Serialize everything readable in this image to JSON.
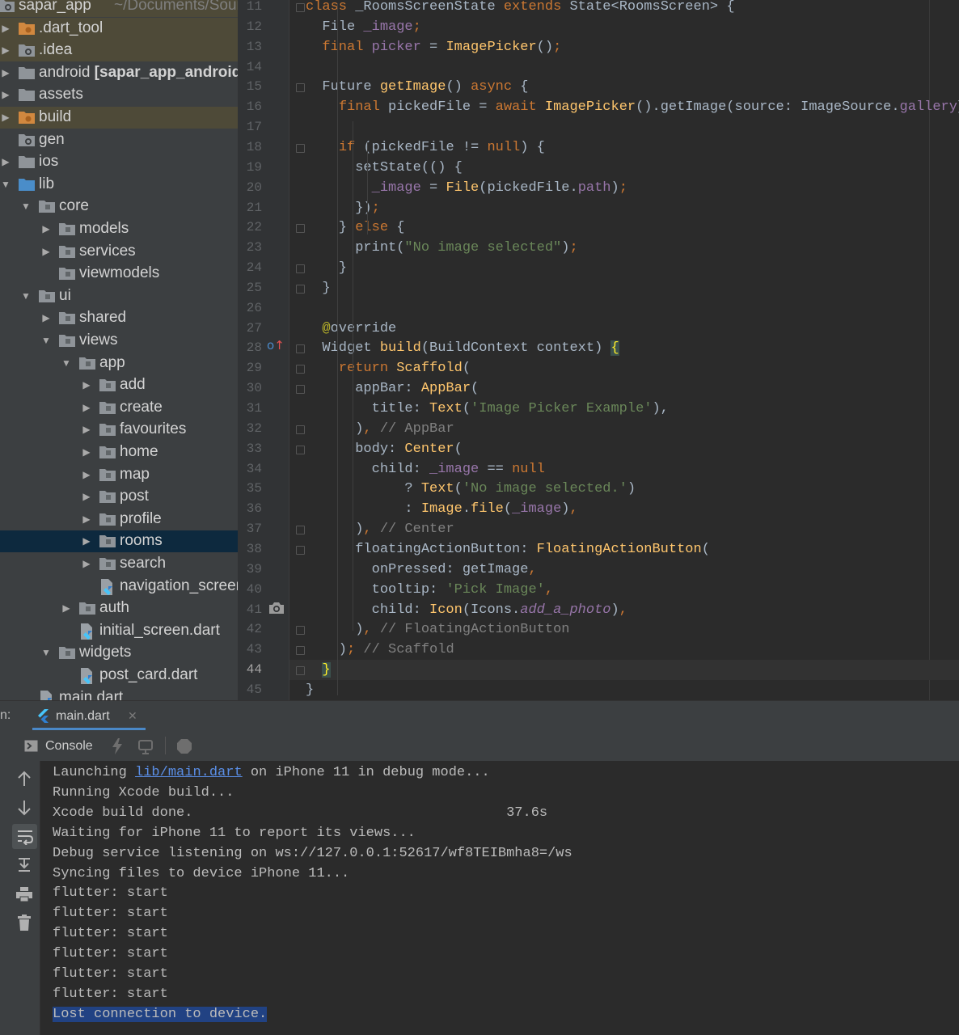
{
  "project_tree": {
    "items": [
      {
        "depth": 0,
        "type": "folder",
        "arrow": "right",
        "label": "sapar_app",
        "extra": "~/Documents/Sources",
        "color": "module",
        "highlight": "tan"
      },
      {
        "depth": 1,
        "type": "folder",
        "arrow": "right",
        "label": ".dart_tool",
        "color": "orange",
        "highlight": "tan"
      },
      {
        "depth": 1,
        "type": "folder",
        "arrow": "right",
        "label": ".idea",
        "color": "gray-gear",
        "highlight": "tan"
      },
      {
        "depth": 1,
        "type": "folder",
        "arrow": "right",
        "label": "android",
        "label_bold": "[sapar_app_android]",
        "color": "gray"
      },
      {
        "depth": 1,
        "type": "folder",
        "arrow": "right",
        "label": "assets",
        "color": "gray"
      },
      {
        "depth": 1,
        "type": "folder",
        "arrow": "right",
        "label": "build",
        "color": "orange",
        "highlight": "tan"
      },
      {
        "depth": 1,
        "type": "folder",
        "arrow": "none",
        "label": "gen",
        "color": "gray-gear"
      },
      {
        "depth": 1,
        "type": "folder",
        "arrow": "right",
        "label": "ios",
        "color": "gray"
      },
      {
        "depth": 1,
        "type": "folder",
        "arrow": "down",
        "label": "lib",
        "color": "blue"
      },
      {
        "depth": 2,
        "type": "folder",
        "arrow": "down",
        "label": "core",
        "color": "gray-dot"
      },
      {
        "depth": 3,
        "type": "folder",
        "arrow": "right",
        "label": "models",
        "color": "gray-dot"
      },
      {
        "depth": 3,
        "type": "folder",
        "arrow": "right",
        "label": "services",
        "color": "gray-dot"
      },
      {
        "depth": 3,
        "type": "folder",
        "arrow": "none",
        "label": "viewmodels",
        "color": "gray-dot"
      },
      {
        "depth": 2,
        "type": "folder",
        "arrow": "down",
        "label": "ui",
        "color": "gray-dot"
      },
      {
        "depth": 3,
        "type": "folder",
        "arrow": "right",
        "label": "shared",
        "color": "gray-dot"
      },
      {
        "depth": 3,
        "type": "folder",
        "arrow": "down",
        "label": "views",
        "color": "gray-dot"
      },
      {
        "depth": 4,
        "type": "folder",
        "arrow": "down",
        "label": "app",
        "color": "gray-dot"
      },
      {
        "depth": 5,
        "type": "folder",
        "arrow": "right",
        "label": "add",
        "color": "gray-dot"
      },
      {
        "depth": 5,
        "type": "folder",
        "arrow": "right",
        "label": "create",
        "color": "gray-dot"
      },
      {
        "depth": 5,
        "type": "folder",
        "arrow": "right",
        "label": "favourites",
        "color": "gray-dot"
      },
      {
        "depth": 5,
        "type": "folder",
        "arrow": "right",
        "label": "home",
        "color": "gray-dot"
      },
      {
        "depth": 5,
        "type": "folder",
        "arrow": "right",
        "label": "map",
        "color": "gray-dot"
      },
      {
        "depth": 5,
        "type": "folder",
        "arrow": "right",
        "label": "post",
        "color": "gray-dot"
      },
      {
        "depth": 5,
        "type": "folder",
        "arrow": "right",
        "label": "profile",
        "color": "gray-dot"
      },
      {
        "depth": 5,
        "type": "folder",
        "arrow": "right",
        "label": "rooms",
        "color": "gray-dot",
        "selected": true
      },
      {
        "depth": 5,
        "type": "folder",
        "arrow": "right",
        "label": "search",
        "color": "gray-dot"
      },
      {
        "depth": 5,
        "type": "file",
        "arrow": "none",
        "label": "navigation_screen.dart"
      },
      {
        "depth": 4,
        "type": "folder",
        "arrow": "right",
        "label": "auth",
        "color": "gray-dot"
      },
      {
        "depth": 4,
        "type": "file",
        "arrow": "none",
        "label": "initial_screen.dart"
      },
      {
        "depth": 3,
        "type": "folder",
        "arrow": "down",
        "label": "widgets",
        "color": "gray-dot"
      },
      {
        "depth": 4,
        "type": "file",
        "arrow": "none",
        "label": "post_card.dart"
      },
      {
        "depth": 2,
        "type": "file",
        "arrow": "none",
        "label": "main.dart"
      }
    ]
  },
  "editor": {
    "current_line": 44,
    "lines": [
      {
        "n": 11,
        "t": [
          [
            "kw",
            "class "
          ],
          [
            "",
            "_RoomsScreenState "
          ],
          [
            "kw",
            "extends "
          ],
          [
            "",
            "State<RoomsScreen> {"
          ]
        ]
      },
      {
        "n": 12,
        "t": [
          [
            "",
            "  File "
          ],
          [
            "fld",
            "_image"
          ],
          [
            "kw",
            ";"
          ]
        ]
      },
      {
        "n": 13,
        "t": [
          [
            "",
            "  "
          ],
          [
            "kw",
            "final "
          ],
          [
            "fld",
            "picker "
          ],
          [
            "",
            "= "
          ],
          [
            "ty",
            "ImagePicker"
          ],
          [
            "",
            "()"
          ],
          [
            "kw",
            ";"
          ]
        ]
      },
      {
        "n": 14,
        "t": []
      },
      {
        "n": 15,
        "t": [
          [
            "",
            "  Future "
          ],
          [
            "ty",
            "getImage"
          ],
          [
            "",
            "() "
          ],
          [
            "kw",
            "async "
          ],
          [
            "",
            "{"
          ]
        ]
      },
      {
        "n": 16,
        "t": [
          [
            "",
            "    "
          ],
          [
            "kw",
            "final "
          ],
          [
            "",
            "pickedFile = "
          ],
          [
            "kw",
            "await "
          ],
          [
            "ty",
            "ImagePicker"
          ],
          [
            "",
            "().getImage(source: ImageSource."
          ],
          [
            "fld",
            "gallery"
          ],
          [
            "",
            "}"
          ],
          [
            "kw",
            ";"
          ]
        ]
      },
      {
        "n": 17,
        "t": []
      },
      {
        "n": 18,
        "t": [
          [
            "",
            "    "
          ],
          [
            "kw",
            "if "
          ],
          [
            "",
            "(pickedFile != "
          ],
          [
            "kw",
            "null"
          ],
          [
            "",
            ") {"
          ]
        ]
      },
      {
        "n": 19,
        "t": [
          [
            "",
            "      setState(() {"
          ]
        ]
      },
      {
        "n": 20,
        "t": [
          [
            "",
            "        "
          ],
          [
            "fld",
            "_image "
          ],
          [
            "",
            "= "
          ],
          [
            "ty",
            "File"
          ],
          [
            "",
            "(pickedFile."
          ],
          [
            "fld",
            "path"
          ],
          [
            "",
            ")"
          ],
          [
            "kw",
            ";"
          ]
        ]
      },
      {
        "n": 21,
        "t": [
          [
            "",
            "      })"
          ],
          [
            "kw",
            ";"
          ]
        ]
      },
      {
        "n": 22,
        "t": [
          [
            "",
            "    } "
          ],
          [
            "kw",
            "else "
          ],
          [
            "",
            "{"
          ]
        ]
      },
      {
        "n": 23,
        "t": [
          [
            "",
            "      print("
          ],
          [
            "str",
            "\"No image selected\""
          ],
          [
            "",
            ")"
          ],
          [
            "kw",
            ";"
          ]
        ]
      },
      {
        "n": 24,
        "t": [
          [
            "",
            "    }"
          ]
        ]
      },
      {
        "n": 25,
        "t": [
          [
            "",
            "  }"
          ]
        ]
      },
      {
        "n": 26,
        "t": []
      },
      {
        "n": 27,
        "t": [
          [
            "",
            "  "
          ],
          [
            "ann",
            "@"
          ],
          [
            "",
            "override"
          ]
        ]
      },
      {
        "n": 28,
        "t": [
          [
            "",
            "  Widget "
          ],
          [
            "ty",
            "build"
          ],
          [
            "",
            "(BuildContext context) "
          ],
          [
            "brk",
            "{"
          ]
        ]
      },
      {
        "n": 29,
        "t": [
          [
            "",
            "    "
          ],
          [
            "kw",
            "return "
          ],
          [
            "ty",
            "Scaffold"
          ],
          [
            "",
            "("
          ]
        ]
      },
      {
        "n": 30,
        "t": [
          [
            "",
            "      appBar: "
          ],
          [
            "ty",
            "AppBar"
          ],
          [
            "",
            "("
          ]
        ]
      },
      {
        "n": 31,
        "t": [
          [
            "",
            "        title: "
          ],
          [
            "ty",
            "Text"
          ],
          [
            "",
            "("
          ],
          [
            "str",
            "'Image Picker Example'"
          ],
          [
            "",
            "),"
          ]
        ]
      },
      {
        "n": 32,
        "t": [
          [
            "",
            "      )"
          ],
          [
            "kw",
            ", "
          ],
          [
            "cm",
            "// AppBar"
          ]
        ]
      },
      {
        "n": 33,
        "t": [
          [
            "",
            "      body: "
          ],
          [
            "ty",
            "Center"
          ],
          [
            "",
            "("
          ]
        ]
      },
      {
        "n": 34,
        "t": [
          [
            "",
            "        child: "
          ],
          [
            "fld",
            "_image "
          ],
          [
            "",
            "== "
          ],
          [
            "kw",
            "null"
          ]
        ]
      },
      {
        "n": 35,
        "t": [
          [
            "",
            "            ? "
          ],
          [
            "ty",
            "Text"
          ],
          [
            "",
            "("
          ],
          [
            "str",
            "'No image selected.'"
          ],
          [
            "",
            ")"
          ]
        ]
      },
      {
        "n": 36,
        "t": [
          [
            "",
            "            : "
          ],
          [
            "ty",
            "Image"
          ],
          [
            "",
            "."
          ],
          [
            "ty",
            "file"
          ],
          [
            "",
            "("
          ],
          [
            "fld",
            "_image"
          ],
          [
            "",
            ")"
          ],
          [
            "kw",
            ","
          ]
        ]
      },
      {
        "n": 37,
        "t": [
          [
            "",
            "      )"
          ],
          [
            "kw",
            ", "
          ],
          [
            "cm",
            "// Center"
          ]
        ]
      },
      {
        "n": 38,
        "t": [
          [
            "",
            "      floatingActionButton: "
          ],
          [
            "ty",
            "FloatingActionButton"
          ],
          [
            "",
            "("
          ]
        ]
      },
      {
        "n": 39,
        "t": [
          [
            "",
            "        onPressed: getImage"
          ],
          [
            "kw",
            ","
          ]
        ]
      },
      {
        "n": 40,
        "t": [
          [
            "",
            "        tooltip: "
          ],
          [
            "str",
            "'Pick Image'"
          ],
          [
            "kw",
            ","
          ]
        ]
      },
      {
        "n": 41,
        "t": [
          [
            "",
            "        child: "
          ],
          [
            "ty",
            "Icon"
          ],
          [
            "",
            "(Icons."
          ],
          [
            "it",
            "add_a_photo"
          ],
          [
            "",
            ")"
          ],
          [
            "kw",
            ","
          ]
        ]
      },
      {
        "n": 42,
        "t": [
          [
            "",
            "      )"
          ],
          [
            "kw",
            ", "
          ],
          [
            "cm",
            "// FloatingActionButton"
          ]
        ]
      },
      {
        "n": 43,
        "t": [
          [
            "",
            "    )"
          ],
          [
            "kw",
            "; "
          ],
          [
            "cm",
            "// Scaffold"
          ]
        ]
      },
      {
        "n": 44,
        "t": [
          [
            "",
            "  "
          ],
          [
            "brk",
            "}"
          ]
        ]
      },
      {
        "n": 45,
        "t": [
          [
            "",
            "}"
          ]
        ]
      }
    ]
  },
  "run_panel": {
    "label": "n:",
    "tab": "main.dart",
    "console_label": "Console"
  },
  "console": {
    "lines": [
      {
        "parts": [
          [
            "",
            "Launching "
          ],
          [
            "link",
            "lib/main.dart"
          ],
          [
            "",
            " on iPhone 11 in debug mode..."
          ]
        ]
      },
      {
        "parts": [
          [
            "",
            "Running Xcode build..."
          ]
        ]
      },
      {
        "parts": [
          [
            "",
            "Xcode build done.                                      37.6s"
          ]
        ]
      },
      {
        "parts": [
          [
            "",
            "Waiting for iPhone 11 to report its views..."
          ]
        ]
      },
      {
        "parts": [
          [
            "",
            "Debug service listening on ws://127.0.0.1:52617/wf8TEIBmha8=/ws"
          ]
        ]
      },
      {
        "parts": [
          [
            "",
            "Syncing files to device iPhone 11..."
          ]
        ]
      },
      {
        "parts": [
          [
            "",
            "flutter: start"
          ]
        ]
      },
      {
        "parts": [
          [
            "",
            "flutter: start"
          ]
        ]
      },
      {
        "parts": [
          [
            "",
            "flutter: start"
          ]
        ]
      },
      {
        "parts": [
          [
            "",
            "flutter: start"
          ]
        ]
      },
      {
        "parts": [
          [
            "",
            "flutter: start"
          ]
        ]
      },
      {
        "parts": [
          [
            "",
            "flutter: start"
          ]
        ]
      },
      {
        "parts": [
          [
            "",
            "Lost connection to device."
          ]
        ],
        "selected": true
      }
    ]
  },
  "colors": {
    "tree_bg": "#3c3f41",
    "editor_bg": "#2b2b2b",
    "keyword": "#cc7832",
    "function": "#ffc66d",
    "string": "#6a8759",
    "field": "#9876aa",
    "comment": "#808080",
    "selection": "#0d293e",
    "highlight": "#4e4a38"
  }
}
